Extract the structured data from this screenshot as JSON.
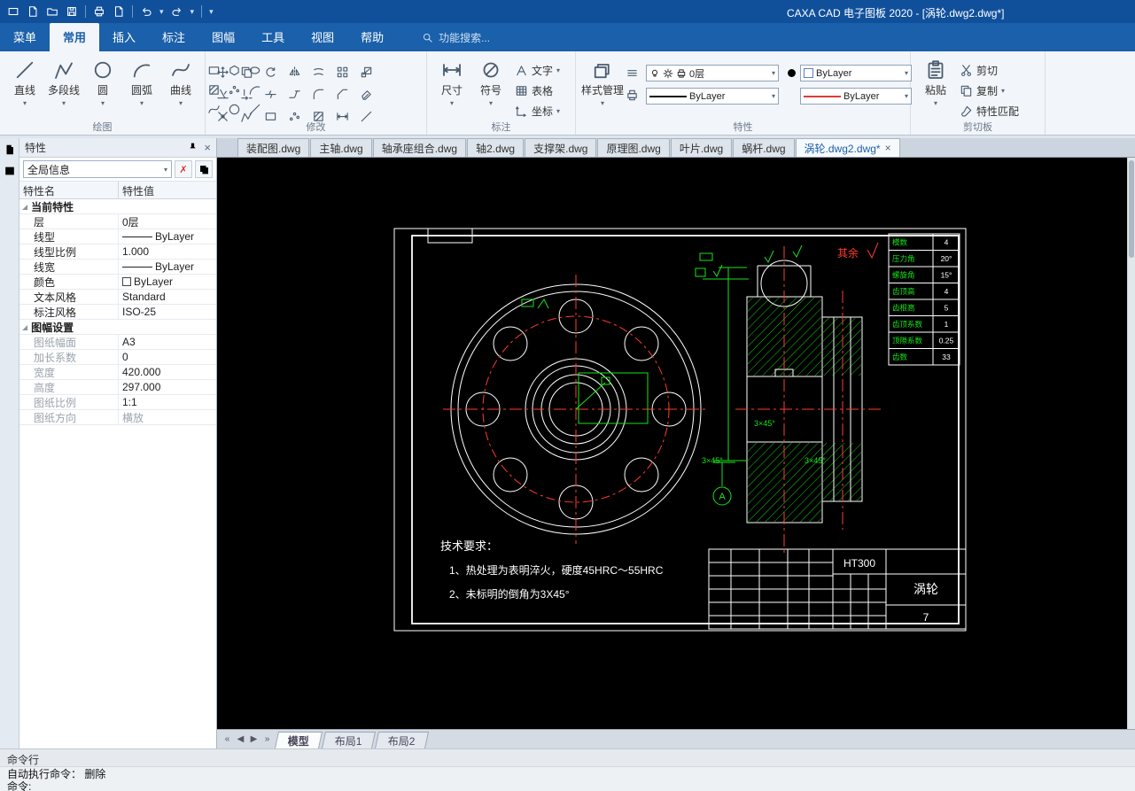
{
  "window": {
    "title": "CAXA CAD 电子图板 2020 - [涡轮.dwg2.dwg*]"
  },
  "menu": {
    "items": [
      "菜单",
      "常用",
      "插入",
      "标注",
      "图幅",
      "工具",
      "视图",
      "帮助"
    ],
    "active_index": 1,
    "search_label": "功能搜索..."
  },
  "ribbon": {
    "groups": {
      "draw": {
        "label": "绘图",
        "tools": [
          "直线",
          "多段线",
          "圆",
          "圆弧",
          "曲线"
        ]
      },
      "modify": {
        "label": "修改"
      },
      "annotate": {
        "label": "标注",
        "dim": "尺寸",
        "symbol": "符号",
        "text": "文字",
        "table": "表格",
        "coord": "坐标"
      },
      "properties": {
        "label": "特性",
        "style_manager": "样式管理",
        "layer": "0层",
        "color": "ByLayer",
        "linetype": "ByLayer",
        "lineweight": "ByLayer"
      },
      "clipboard": {
        "label": "剪切板",
        "paste": "粘贴",
        "cut": "剪切",
        "copy": "复制",
        "match": "特性匹配"
      }
    }
  },
  "doc_tabs": {
    "tabs": [
      "装配图.dwg",
      "主轴.dwg",
      "轴承座组合.dwg",
      "轴2.dwg",
      "支撑架.dwg",
      "原理图.dwg",
      "叶片.dwg",
      "蜗杆.dwg",
      "涡轮.dwg2.dwg*"
    ],
    "active": "涡轮.dwg2.dwg*"
  },
  "props_panel": {
    "title": "特性",
    "selector": "全局信息",
    "col1": "特性名",
    "col2": "特性值",
    "rows": [
      {
        "t": "g",
        "label": "当前特性"
      },
      {
        "label": "层",
        "value": "0层"
      },
      {
        "label": "线型",
        "value": "ByLayer",
        "swatch": "line"
      },
      {
        "label": "线型比例",
        "value": "1.000"
      },
      {
        "label": "线宽",
        "value": "ByLayer",
        "swatch": "line"
      },
      {
        "label": "颜色",
        "value": "ByLayer",
        "swatch": "colorbox"
      },
      {
        "label": "文本风格",
        "value": "Standard"
      },
      {
        "label": "标注风格",
        "value": "ISO-25"
      },
      {
        "t": "g",
        "label": "图幅设置"
      },
      {
        "label": "图纸幅面",
        "value": "A3",
        "dim": true
      },
      {
        "label": "加长系数",
        "value": "0",
        "dim": true
      },
      {
        "label": "宽度",
        "value": "420.000",
        "dim": true
      },
      {
        "label": "高度",
        "value": "297.000",
        "dim": true
      },
      {
        "label": "图纸比例",
        "value": "1:1",
        "dim": true
      },
      {
        "label": "图纸方向",
        "value": "横放",
        "dim": true,
        "vdim": true
      }
    ]
  },
  "drawing": {
    "tech_req": {
      "title": "技术要求：",
      "lines": [
        "1、热处理为表明淬火，硬度45HRC～55HRC",
        "2、未标明的倒角为3X45°"
      ]
    },
    "gear_table": {
      "rows": [
        [
          "模数",
          "4"
        ],
        [
          "压力角",
          "20°"
        ],
        [
          "螺旋角",
          "15°"
        ],
        [
          "齿顶高",
          "4"
        ],
        [
          "齿根高",
          "5"
        ],
        [
          "齿顶系数",
          "1"
        ],
        [
          "顶隙系数",
          "0.25"
        ],
        [
          "齿数",
          "33"
        ]
      ]
    },
    "title_block": {
      "material": "HT300",
      "part_name": "涡轮",
      "sheet": "7"
    },
    "annotations": {
      "surface_note": "其余",
      "chamfer": "3×45°",
      "view_label": "A"
    }
  },
  "model_tabs": {
    "tabs": [
      "模型",
      "布局1",
      "布局2"
    ],
    "active": "模型"
  },
  "command": {
    "title": "命令行",
    "lines": [
      "自动执行命令：  删除",
      "命令:"
    ]
  },
  "colors": {
    "titlebar": "#10509b",
    "menubar": "#1a60aa",
    "ribbon_bg": "#f2f5f9",
    "canvas_bg": "#000000",
    "line_white": "#ffffff",
    "line_red": "#ff3b30",
    "line_green": "#17e317"
  }
}
